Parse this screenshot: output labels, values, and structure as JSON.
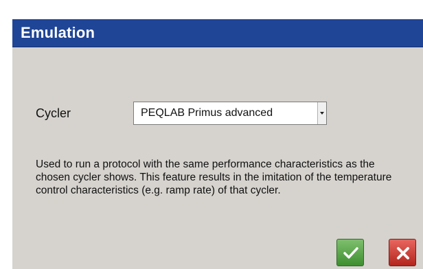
{
  "dialog": {
    "title": "Emulation"
  },
  "cycler": {
    "label": "Cycler",
    "selected": "PEQLAB Primus advanced"
  },
  "description": "Used to run a protocol with the same performance characteristics as the chosen cycler shows. This feature results in the imitation of the temperature control characteristics (e.g. ramp rate) of that cycler.",
  "buttons": {
    "ok_icon": "checkmark-icon",
    "cancel_icon": "close-icon"
  },
  "colors": {
    "titlebar": "#1f4596",
    "ok": "#4f9e3f",
    "cancel": "#c8322a"
  }
}
